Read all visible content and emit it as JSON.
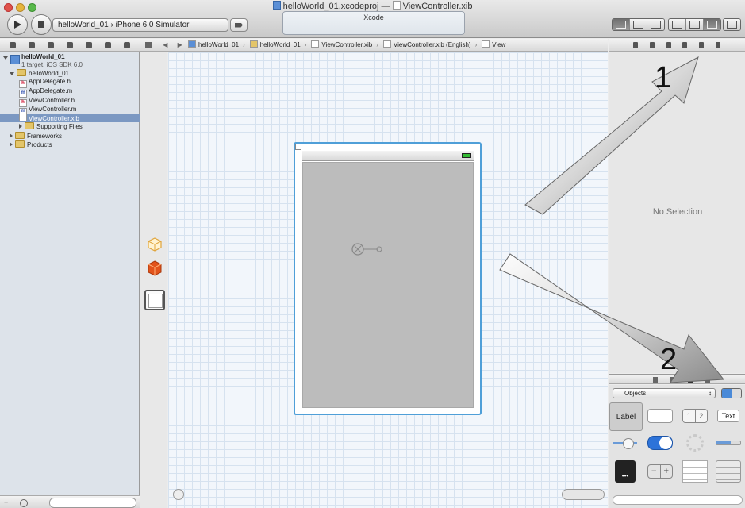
{
  "window": {
    "project_title": "helloWorld_01.xcodeproj",
    "separator": "—",
    "file_title": "ViewController.xib",
    "activity_label": "Xcode"
  },
  "toolbar": {
    "scheme_name": "helloWorld_01",
    "scheme_separator": "›",
    "destination": "iPhone 6.0 Simulator"
  },
  "navigator": {
    "project_name": "helloWorld_01",
    "project_subtitle": "1 target, iOS SDK 6.0",
    "items": [
      {
        "label": "helloWorld_01",
        "kind": "group"
      },
      {
        "label": "AppDelegate.h",
        "kind": "h"
      },
      {
        "label": "AppDelegate.m",
        "kind": "m"
      },
      {
        "label": "ViewController.h",
        "kind": "h"
      },
      {
        "label": "ViewController.m",
        "kind": "m"
      },
      {
        "label": "ViewController.xib",
        "kind": "xib",
        "selected": true
      },
      {
        "label": "Supporting Files",
        "kind": "group"
      },
      {
        "label": "Frameworks",
        "kind": "group"
      },
      {
        "label": "Products",
        "kind": "group"
      }
    ]
  },
  "jumpbar": {
    "crumbs": [
      "helloWorld_01",
      "helloWorld_01",
      "ViewController.xib",
      "ViewController.xib (English)",
      "View"
    ]
  },
  "inspector": {
    "empty_label": "No Selection"
  },
  "library": {
    "selector_value": "Objects",
    "tiles": {
      "label": "Label",
      "segmented_1": "1",
      "segmented_2": "2",
      "text_field": "Text"
    }
  },
  "annotations": {
    "arrow_1_label": "1",
    "arrow_2_label": "2"
  },
  "colors": {
    "selection_blue": "#4f9fd8",
    "nav_selection": "#7b98c2",
    "switch_blue": "#2d73d9"
  }
}
